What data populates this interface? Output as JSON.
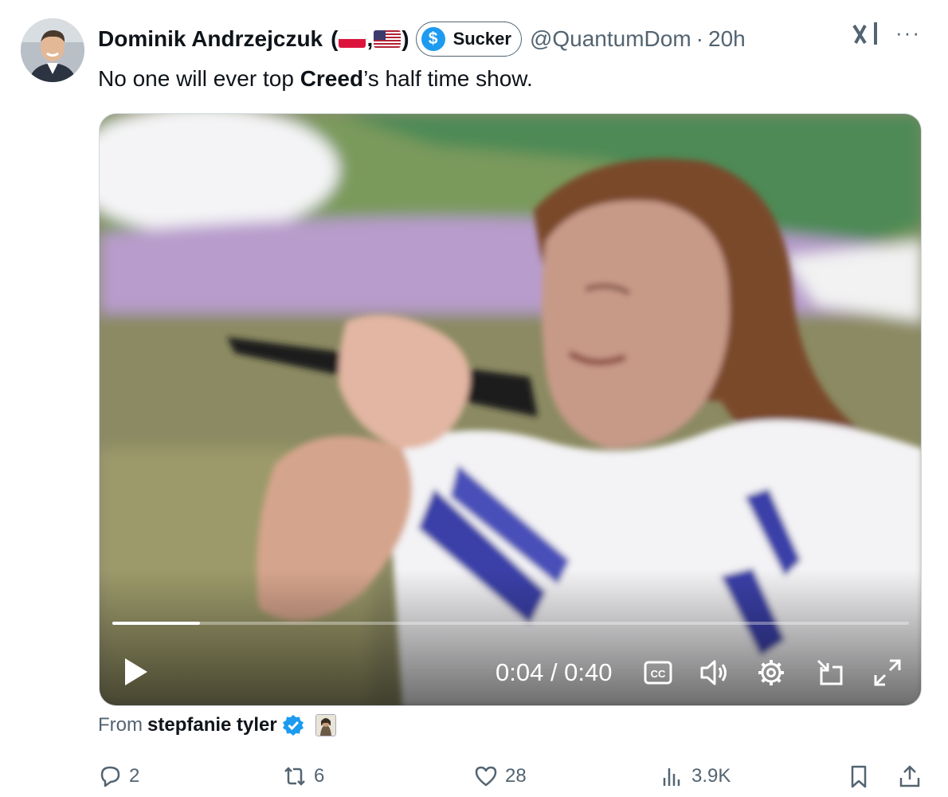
{
  "tweet": {
    "author_name": "Dominik Andrzejczuk",
    "name_suffix_open": "(",
    "name_suffix_comma": ",",
    "name_suffix_close": ")",
    "flags": [
      "poland-flag",
      "usa-flag"
    ],
    "badge_label": "Sucker",
    "handle": "@QuantumDom",
    "separator": "·",
    "time": "20h",
    "more_label": "···",
    "text_before": "No one will ever top ",
    "text_bold": "Creed",
    "text_after": "’s half time show."
  },
  "video": {
    "time_readout": "0:04 / 0:40",
    "progress": 0.11,
    "controls": [
      "play-icon",
      "captions-icon",
      "volume-icon",
      "settings-icon",
      "pip-icon",
      "fullscreen-icon"
    ],
    "cc_label": "CC"
  },
  "attribution": {
    "from_label": "From",
    "source_name": "stepfanie tyler"
  },
  "actions": {
    "replies": "2",
    "reposts": "6",
    "likes": "28",
    "views": "3.9K"
  },
  "colors": {
    "accent": "#1d9bf0",
    "muted_text": "#536471",
    "primary_text": "#0f1419"
  }
}
